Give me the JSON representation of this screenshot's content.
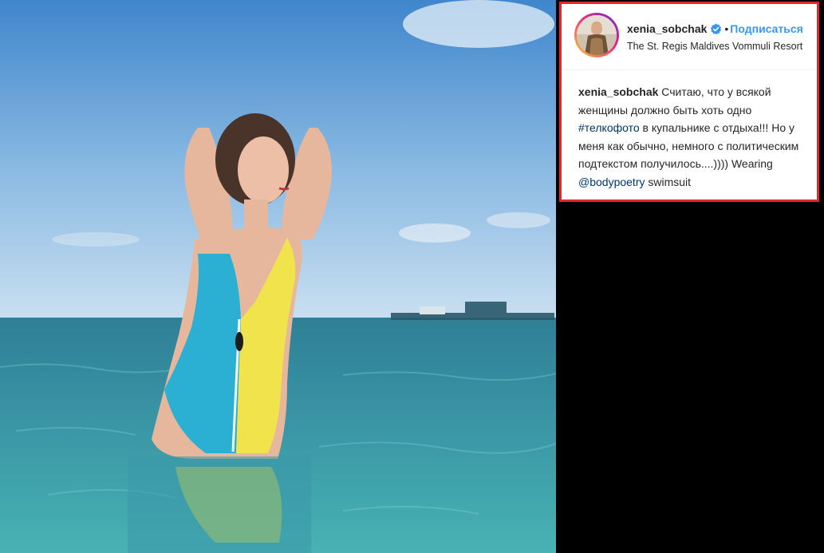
{
  "post": {
    "username": "xenia_sobchak",
    "verified": true,
    "separator": "•",
    "follow_label": "Подписаться",
    "location": "The St. Regis Maldives Vommuli Resort",
    "caption": {
      "username": "xenia_sobchak",
      "text_1": "Считаю, что у всякой женщины должно быть хоть одно",
      "hashtag": "#телкофото",
      "text_2": "в купальнике с отдыха!!! Но у меня как обычно, немного с политическим подтекстом получилось....)))) Wearing",
      "mention": "@bodypoetry",
      "text_3": "swimsuit"
    }
  },
  "colors": {
    "link_blue": "#3897f0",
    "hashtag_blue": "#003569",
    "highlight_border": "#e02a2a",
    "sky_top": "#5b9bd5",
    "sea": "#3a8fa3",
    "swimsuit_blue": "#2eb6d6",
    "swimsuit_yellow": "#f2e34a"
  }
}
